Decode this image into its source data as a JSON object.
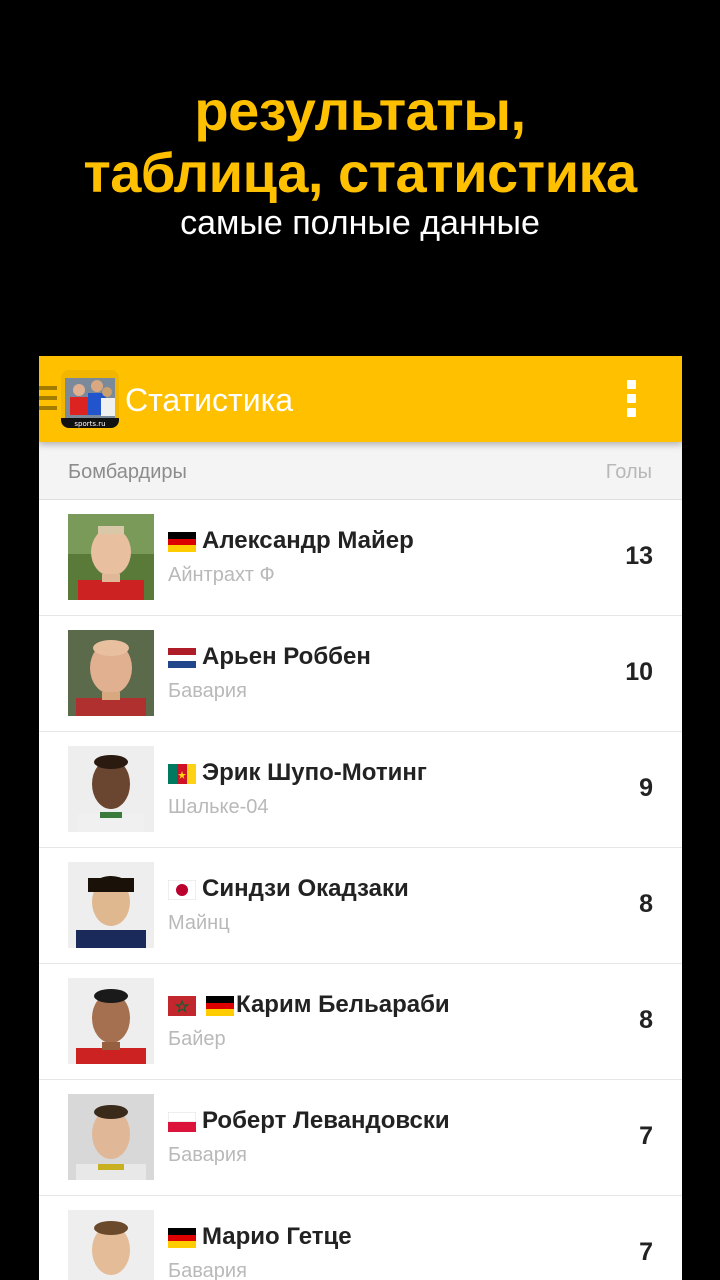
{
  "promo": {
    "line1": "результаты,",
    "line2": "таблица, статистика",
    "subtitle": "самые полные данные"
  },
  "appbar": {
    "title": "Статистика",
    "logo_text": "sports.ru",
    "bg_color": "#FFC000"
  },
  "list_header": {
    "left": "Бомбардиры",
    "right": "Голы"
  },
  "players": [
    {
      "name": "Александр Майер",
      "team": "Айнтрахт Ф",
      "goals": "13",
      "flags": [
        "germany-flag"
      ]
    },
    {
      "name": "Арьен Роббен",
      "team": "Бавария",
      "goals": "10",
      "flags": [
        "netherlands-flag"
      ]
    },
    {
      "name": "Эрик Шупо-Мотинг",
      "team": "Шальке-04",
      "goals": "9",
      "flags": [
        "cameroon-flag"
      ]
    },
    {
      "name": "Синдзи Окадзаки",
      "team": "Майнц",
      "goals": "8",
      "flags": [
        "japan-flag"
      ]
    },
    {
      "name": "Карим Бельараби",
      "team": "Байер",
      "goals": "8",
      "flags": [
        "morocco-flag",
        "germany-flag"
      ]
    },
    {
      "name": "Роберт Левандовски",
      "team": "Бавария",
      "goals": "7",
      "flags": [
        "poland-flag"
      ]
    },
    {
      "name": "Марио Гетце",
      "team": "Бавария",
      "goals": "7",
      "flags": [
        "germany-flag"
      ]
    }
  ]
}
